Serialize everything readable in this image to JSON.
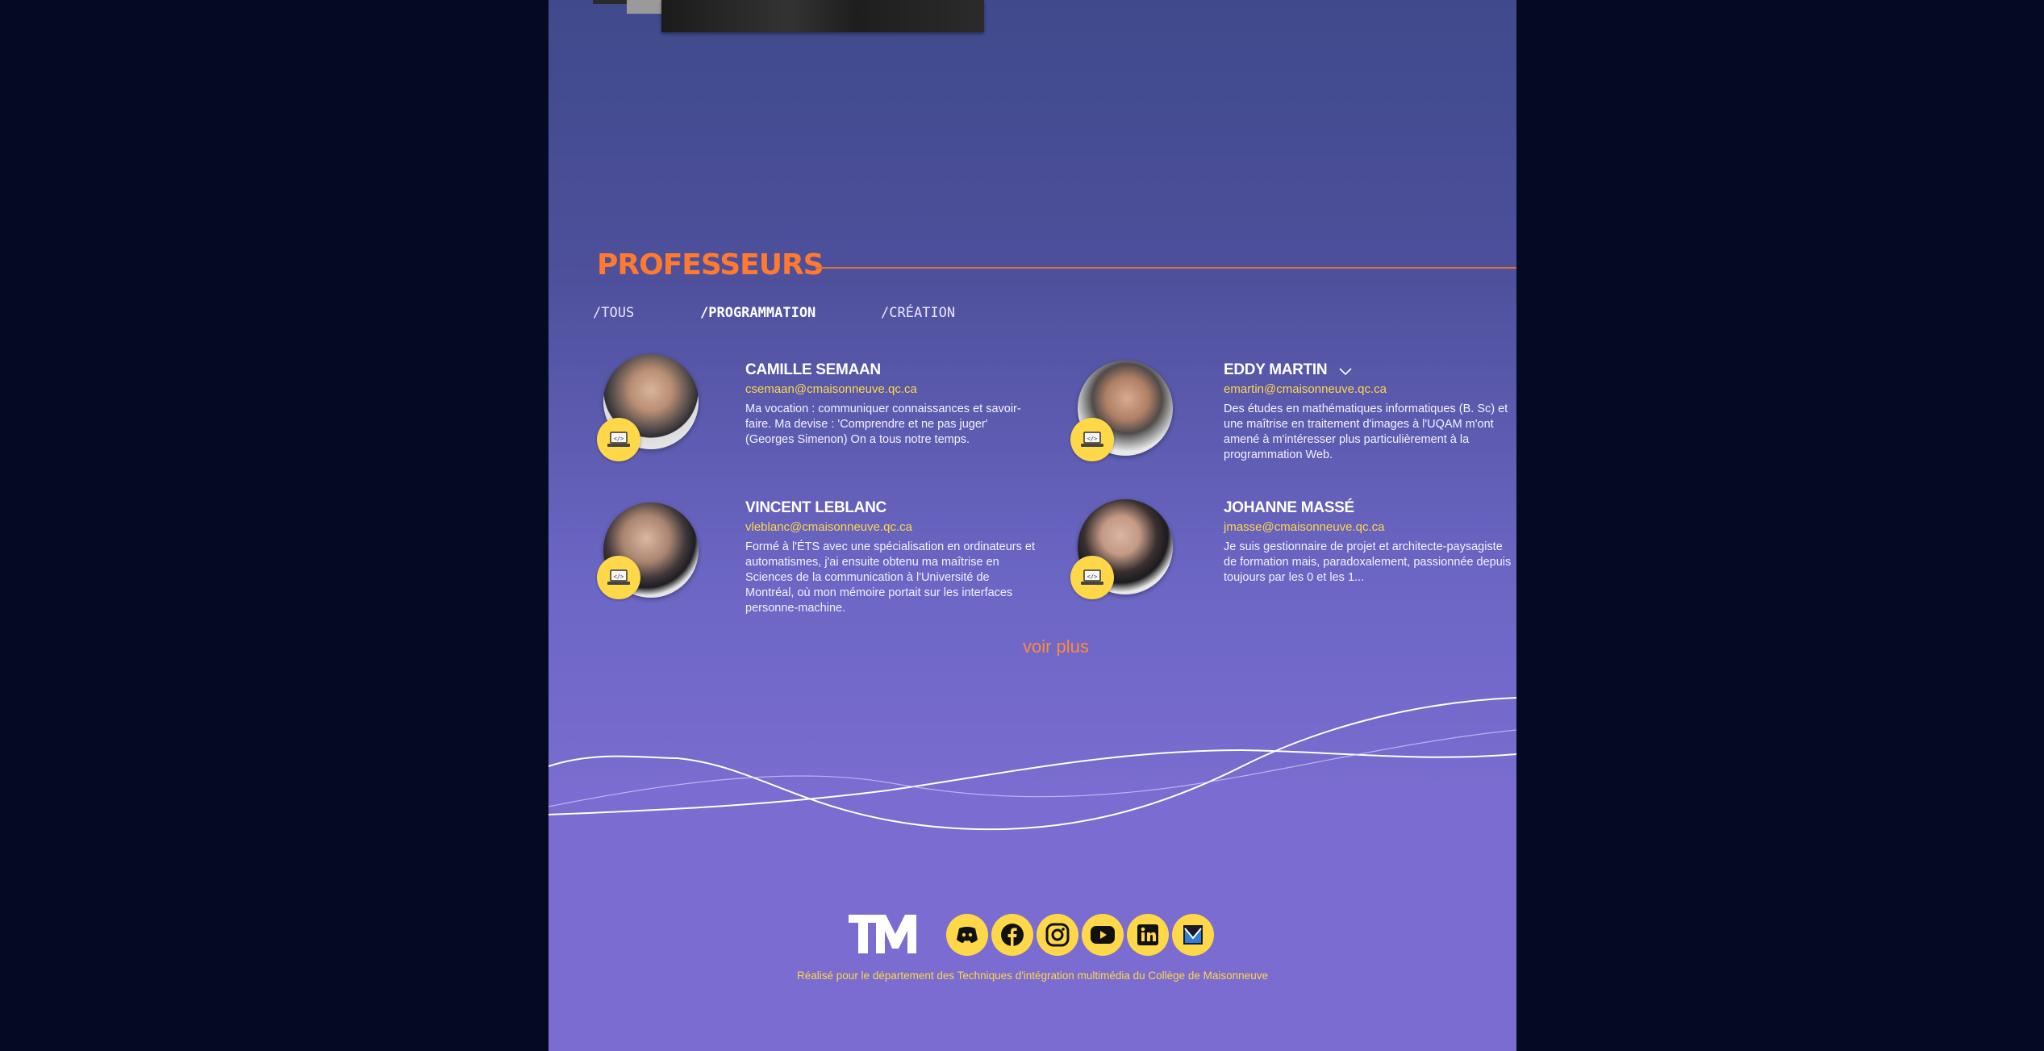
{
  "colors": {
    "outer_bg": "#040a22",
    "accent_orange": "#ff7a2e",
    "accent_yellow": "#ffd84a",
    "text_light": "#f3f2ff"
  },
  "section": {
    "title": "PROFESSEURS"
  },
  "filters": [
    {
      "label": "/TOUS",
      "active": false
    },
    {
      "label": "/PROGRAMMATION",
      "active": true
    },
    {
      "label": "/CRÉATION",
      "active": false
    }
  ],
  "professors": [
    {
      "name": "CAMILLE SEMAAN",
      "email": "csemaan@cmaisonneuve.qc.ca",
      "bio": "Ma vocation : communiquer connaissances et savoir-faire. Ma devise : 'Comprendre et ne pas juger' (Georges Simenon) On a tous notre temps.",
      "badge_icon": "laptop-code-icon"
    },
    {
      "name": "EDDY MARTIN",
      "email": "emartin@cmaisonneuve.qc.ca",
      "bio": "Des études en mathématiques informatiques (B. Sc) et une maîtrise en traitement d'images à l'UQAM m'ont amené à m'intéresser plus particulièrement à la programmation Web.",
      "badge_icon": "laptop-code-icon"
    },
    {
      "name": "VINCENT LEBLANC",
      "email": "vleblanc@cmaisonneuve.qc.ca",
      "bio": "Formé à l'ÉTS avec une spécialisation en ordinateurs et automatismes, j'ai ensuite obtenu ma maîtrise en Sciences de la communication à l'Université de Montréal, où mon mémoire portait sur les interfaces personne-machine.",
      "badge_icon": "laptop-code-icon"
    },
    {
      "name": "JOHANNE MASSÉ",
      "email": "jmasse@cmaisonneuve.qc.ca",
      "bio": "Je suis gestionnaire de projet et architecte-paysagiste de formation mais, paradoxalement, passionnée depuis toujours par les 0 et les 1...",
      "badge_icon": "laptop-code-icon"
    }
  ],
  "voir_plus": "voir plus",
  "footer": {
    "logo_text": "TM",
    "socials": [
      "discord-icon",
      "facebook-icon",
      "instagram-icon",
      "youtube-icon",
      "linkedin-icon",
      "maisonneuve-icon"
    ],
    "credit": "Réalisé pour le département des Techniques d'intégration multimédia du Collège de Maisonneuve"
  }
}
